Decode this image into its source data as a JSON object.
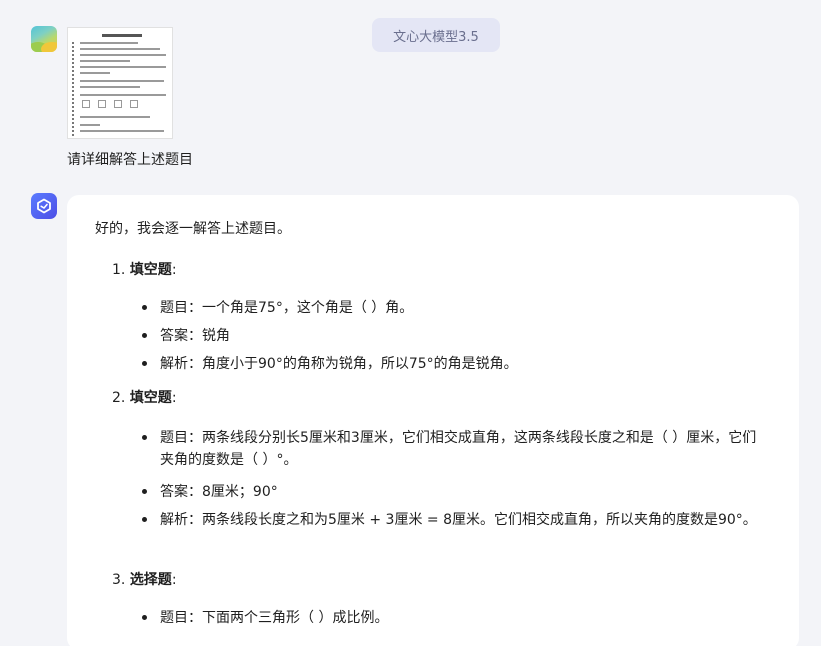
{
  "header": {
    "model_badge": "文心大模型3.5"
  },
  "user_message": {
    "text": "请详细解答上述题目"
  },
  "reply": {
    "intro": "好的，我会逐一解答上述题目。",
    "sections": [
      {
        "number": "1.",
        "title": "填空题",
        "suffix": ":",
        "items": [
          "题目：一个角是75°，这个角是（ ）角。",
          "答案：锐角",
          "解析：角度小于90°的角称为锐角，所以75°的角是锐角。"
        ]
      },
      {
        "number": "2.",
        "title": "填空题",
        "suffix": ":",
        "items": [
          "题目：两条线段分别长5厘米和3厘米，它们相交成直角，这两条线段长度之和是（ ）厘米，它们夹角的度数是（ ）°。",
          "答案：8厘米；90°",
          "解析：两条线段长度之和为5厘米 + 3厘米 = 8厘米。它们相交成直角，所以夹角的度数是90°。"
        ]
      },
      {
        "number": "3.",
        "title": "选择题",
        "suffix": ":",
        "items": [
          "题目：下面两个三角形（ ）成比例。"
        ]
      }
    ]
  }
}
